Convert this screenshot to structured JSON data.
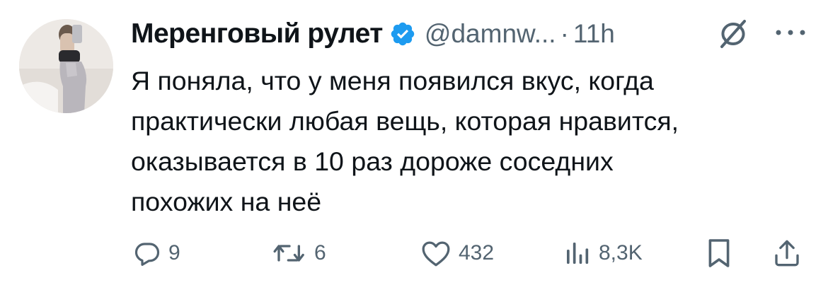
{
  "tweet": {
    "author_name": "Меренговый рулет",
    "handle": "@damnw...",
    "separator": "·",
    "time": "11h",
    "text_lines": [
      "Я поняла, что у меня появился вкус, когда",
      "практически любая вещь, которая нравится,",
      "оказывается в 10 раз дороже соседних",
      "похожих на неё"
    ],
    "verified": true,
    "accent_color": "#1d9bf0",
    "muted_color": "#536471"
  },
  "actions": {
    "replies": {
      "icon": "reply-icon",
      "count": "9"
    },
    "retweets": {
      "icon": "retweet-icon",
      "count": "6"
    },
    "likes": {
      "icon": "heart-icon",
      "count": "432"
    },
    "views": {
      "icon": "analytics-icon",
      "count": "8,3K"
    },
    "bookmark": {
      "icon": "bookmark-icon"
    },
    "share": {
      "icon": "share-icon"
    }
  },
  "header_icons": {
    "grok": "grok-icon",
    "more": "more-dots-icon"
  }
}
